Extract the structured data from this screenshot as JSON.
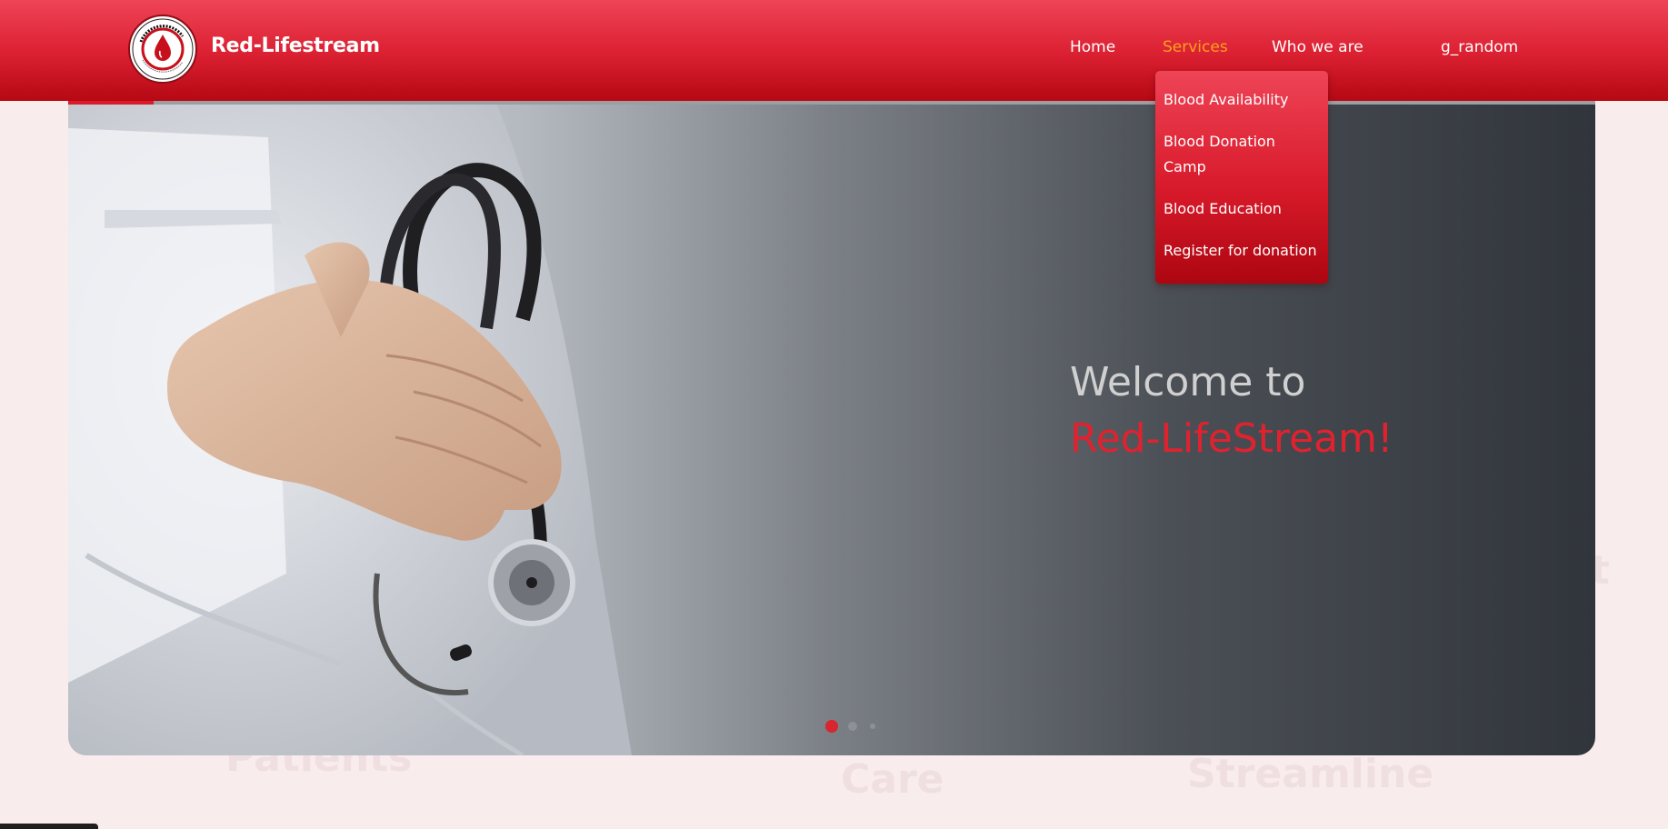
{
  "brand": {
    "name": "Red-Lifestream",
    "logo_icon": "blood-drop-icon"
  },
  "nav": {
    "home": "Home",
    "services": "Services",
    "who_we_are": "Who we are",
    "user": "g_random"
  },
  "services_menu": [
    {
      "label": "Blood Availability"
    },
    {
      "label": "Blood Donation Camp"
    },
    {
      "label": "Blood Education"
    },
    {
      "label": "Register for donation"
    }
  ],
  "hero": {
    "welcome": "Welcome to",
    "brand_line": "Red-LifeStream!",
    "slides_count": 3,
    "active_slide": 1
  },
  "colors": {
    "header_red": "#dd2234",
    "accent_orange": "#f9a21b",
    "brand_red": "#e0222f",
    "page_bg": "#f9eced"
  }
}
